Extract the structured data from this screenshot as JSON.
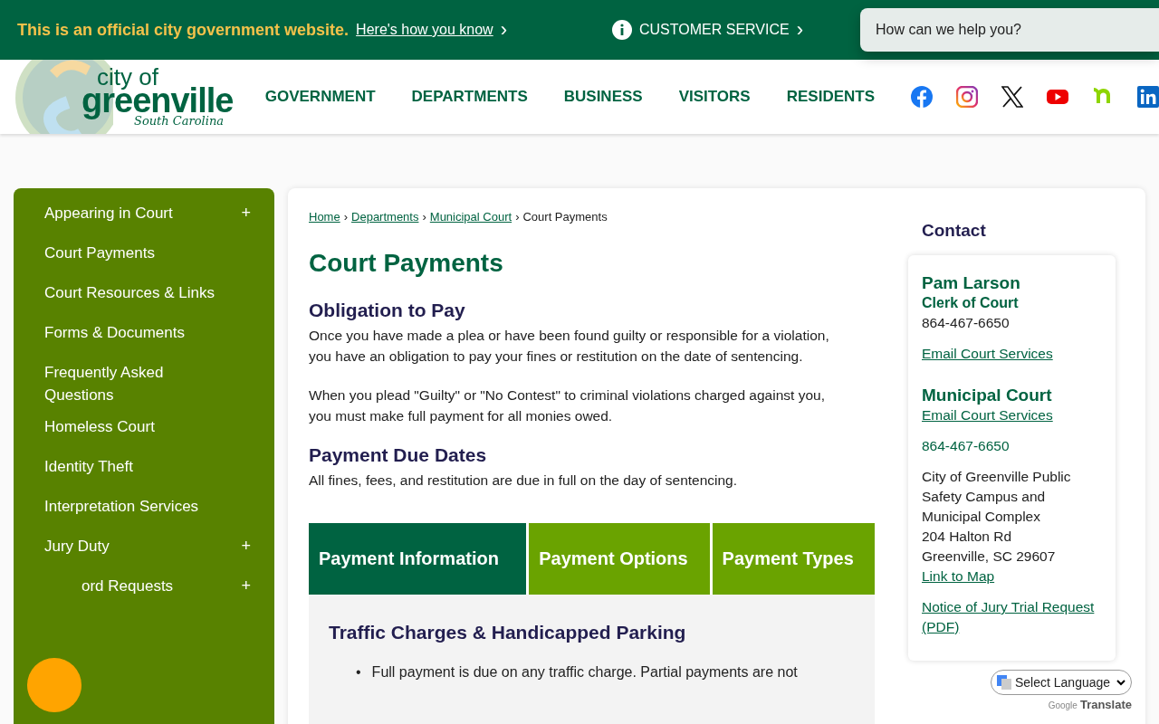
{
  "official_bar": {
    "notice": "This is an official city government website.",
    "link": "Here's how you know",
    "link_caret": "›",
    "service": "CUSTOMER SERVICE",
    "service_caret": "›"
  },
  "search": {
    "placeholder": "How can we help you?"
  },
  "logo": {
    "line1": "city of",
    "line2": "greenville",
    "tagline": "South Carolina"
  },
  "nav": [
    "GOVERNMENT",
    "DEPARTMENTS",
    "BUSINESS",
    "VISITORS",
    "RESIDENTS"
  ],
  "sidebar": {
    "items": [
      {
        "label": "Appearing in Court",
        "toggle": "+"
      },
      {
        "label": "Court Payments"
      },
      {
        "label": "Court Resources & Links"
      },
      {
        "label": "Forms & Documents"
      },
      {
        "label": "Frequently Asked Questions"
      },
      {
        "label": "Homeless Court"
      },
      {
        "label": "Identity Theft"
      },
      {
        "label": "Interpretation Services"
      },
      {
        "label": "Jury Duty",
        "toggle": "+"
      },
      {
        "label": "ord Requests",
        "toggle": "+"
      }
    ]
  },
  "breadcrumb": {
    "separator": "›",
    "links": [
      "Home",
      "Departments",
      "Municipal Court"
    ],
    "current": "Court Payments"
  },
  "page_title": "Court Payments",
  "sections": [
    {
      "heading": "Obligation to Pay",
      "paragraphs": [
        "Once you have made a plea or have been found guilty or responsible for a violation, you have an obligation to pay your fines or restitution on the date of sentencing.",
        "When you plead \"Guilty\" or \"No Contest\" to criminal violations charged against you, you must make full payment for all monies owed."
      ]
    },
    {
      "heading": "Payment Due Dates",
      "paragraphs": [
        "All fines, fees, and restitution are due in full on the day of sentencing."
      ]
    }
  ],
  "tabs": [
    {
      "label": "Payment Information",
      "selected": true
    },
    {
      "label": "Payment Options",
      "selected": false
    },
    {
      "label": "Payment Types",
      "selected": false
    }
  ],
  "tab_panel": {
    "heading": "Traffic Charges & Handicapped Parking",
    "marker": "•",
    "bullets": [
      "Full payment is due on any traffic charge. Partial payments are not"
    ]
  },
  "contact": {
    "title": "Contact",
    "name": "Pam Larson",
    "role": "Clerk of Court",
    "phone": "864-467-6650",
    "email": "Email Court Services",
    "office": "Municipal Court",
    "office_email": "Email Court Services",
    "office_phone": "864-467-6650",
    "address": [
      "City of Greenville Public Safety Campus and Municipal Complex",
      "204 Halton Rd",
      "Greenville, SC 29607"
    ],
    "map_link": "Link to Map",
    "notice_link": "Notice of Jury Trial Request (PDF)"
  },
  "translate": {
    "select": "Select Language",
    "brand": "Google",
    "label": "Translate"
  }
}
